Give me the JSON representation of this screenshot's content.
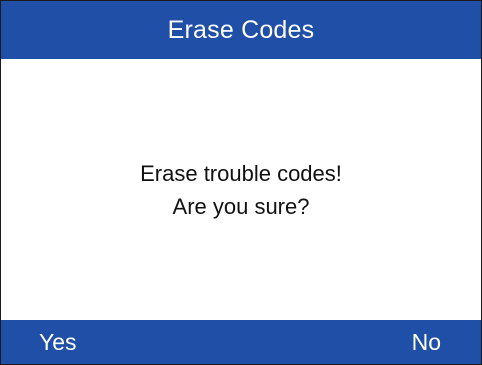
{
  "screen": {
    "title": "Erase Codes"
  },
  "dialog": {
    "line1": "Erase trouble codes!",
    "line2": "Are you sure?"
  },
  "softkeys": {
    "left_label": "Yes",
    "right_label": "No"
  },
  "colors": {
    "accent": "#1f4fa6",
    "background": "#ffffff",
    "text": "#111111",
    "bar_text": "#ffffff"
  }
}
